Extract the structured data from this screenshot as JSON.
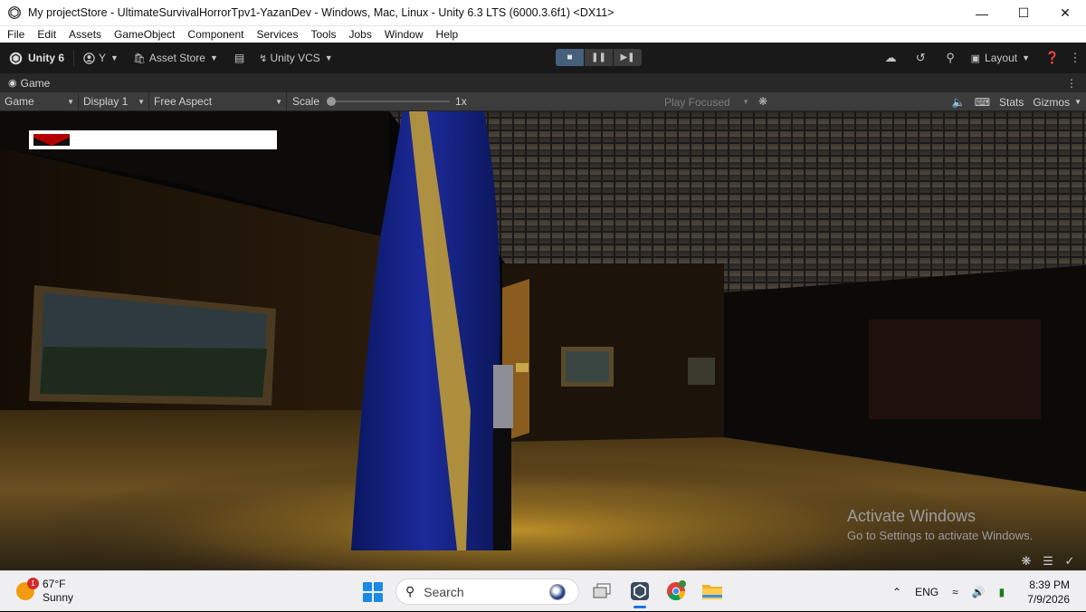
{
  "window": {
    "title": "My projectStore - UltimateSurvivalHorrorTpv1-YazanDev - Windows, Mac, Linux - Unity 6.3 LTS (6000.3.6f1) <DX11>"
  },
  "menu": [
    "File",
    "Edit",
    "Assets",
    "GameObject",
    "Component",
    "Services",
    "Tools",
    "Jobs",
    "Window",
    "Help"
  ],
  "toolbar": {
    "unity_label": "Unity 6",
    "account_label": "Y",
    "asset_store_label": "Asset Store",
    "vcs_label": "Unity VCS",
    "layout_label": "Layout"
  },
  "game_tab": {
    "label": "Game"
  },
  "game_bar": {
    "view_label": "Game",
    "display_label": "Display 1",
    "aspect_label": "Free Aspect",
    "scale_label": "Scale",
    "scale_value": "1x",
    "play_mode_label": "Play Focused",
    "stats_label": "Stats",
    "gizmos_label": "Gizmos"
  },
  "game": {
    "health_fraction": 0.15
  },
  "watermark": {
    "line1": "Activate Windows",
    "line2": "Go to Settings to activate Windows."
  },
  "taskbar": {
    "weather_temp": "67°F",
    "weather_desc": "Sunny",
    "weather_badge": "1",
    "search_label": "Search",
    "language": "ENG",
    "time": "8:39 PM",
    "date": "7/9/2026"
  }
}
